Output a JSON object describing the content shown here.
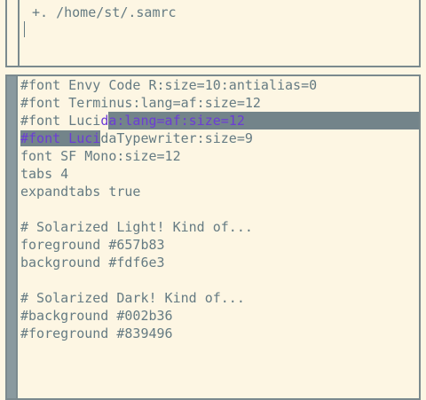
{
  "tag": {
    "text": "+. /home/st/.samrc"
  },
  "lines": [
    {
      "a": "#font Envy Code R:size=10:antialias=0"
    },
    {
      "a": "#font Terminus:lang=af:size=12"
    },
    {
      "a": "#font Luci",
      "b": "da:lang=af:size=12",
      "selected": "partial-end"
    },
    {
      "a": "#font Luci",
      "b": "daTypewriter:size=9",
      "selected": "partial-start"
    },
    {
      "a": "font SF Mono:size=12"
    },
    {
      "a": "tabs 4"
    },
    {
      "a": "expandtabs true"
    },
    {
      "a": ""
    },
    {
      "a": "# Solarized Light! Kind of..."
    },
    {
      "a": "foreground #657b83"
    },
    {
      "a": "background #fdf6e3"
    },
    {
      "a": ""
    },
    {
      "a": "# Solarized Dark! Kind of..."
    },
    {
      "a": "#background #002b36"
    },
    {
      "a": "#foreground #839496"
    }
  ],
  "colors": {
    "background": "#fdf6e3",
    "foreground": "#657b83",
    "border": "#7b8a8e",
    "selection_bg": "#73848a",
    "selection_fg": "#6c3cd6"
  }
}
